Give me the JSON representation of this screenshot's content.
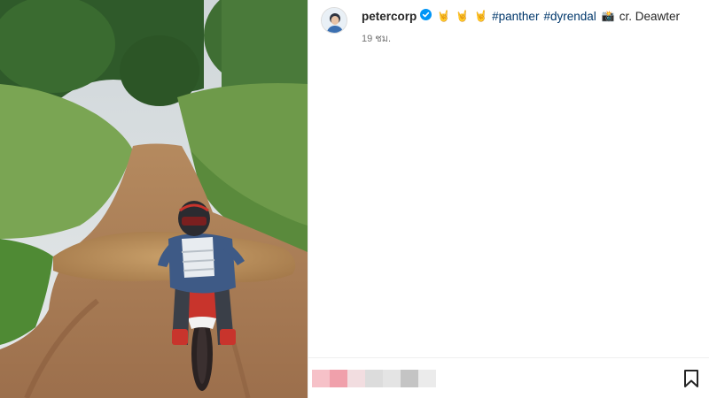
{
  "post": {
    "username": "petercorp",
    "emoji_1": "🤘",
    "emoji_2": "🤘",
    "emoji_3": "🤘",
    "hashtag_1": "#panther",
    "hashtag_2": "#dyrendal",
    "emoji_camera": "📸",
    "credit": "cr. Deawter",
    "timestamp": "19 ชม."
  },
  "icons": {
    "verified": "verified-badge-icon",
    "bookmark": "bookmark-icon"
  },
  "colors": {
    "hashtag": "#00376b",
    "verified": "#0095f6",
    "muted_text": "#737373"
  }
}
